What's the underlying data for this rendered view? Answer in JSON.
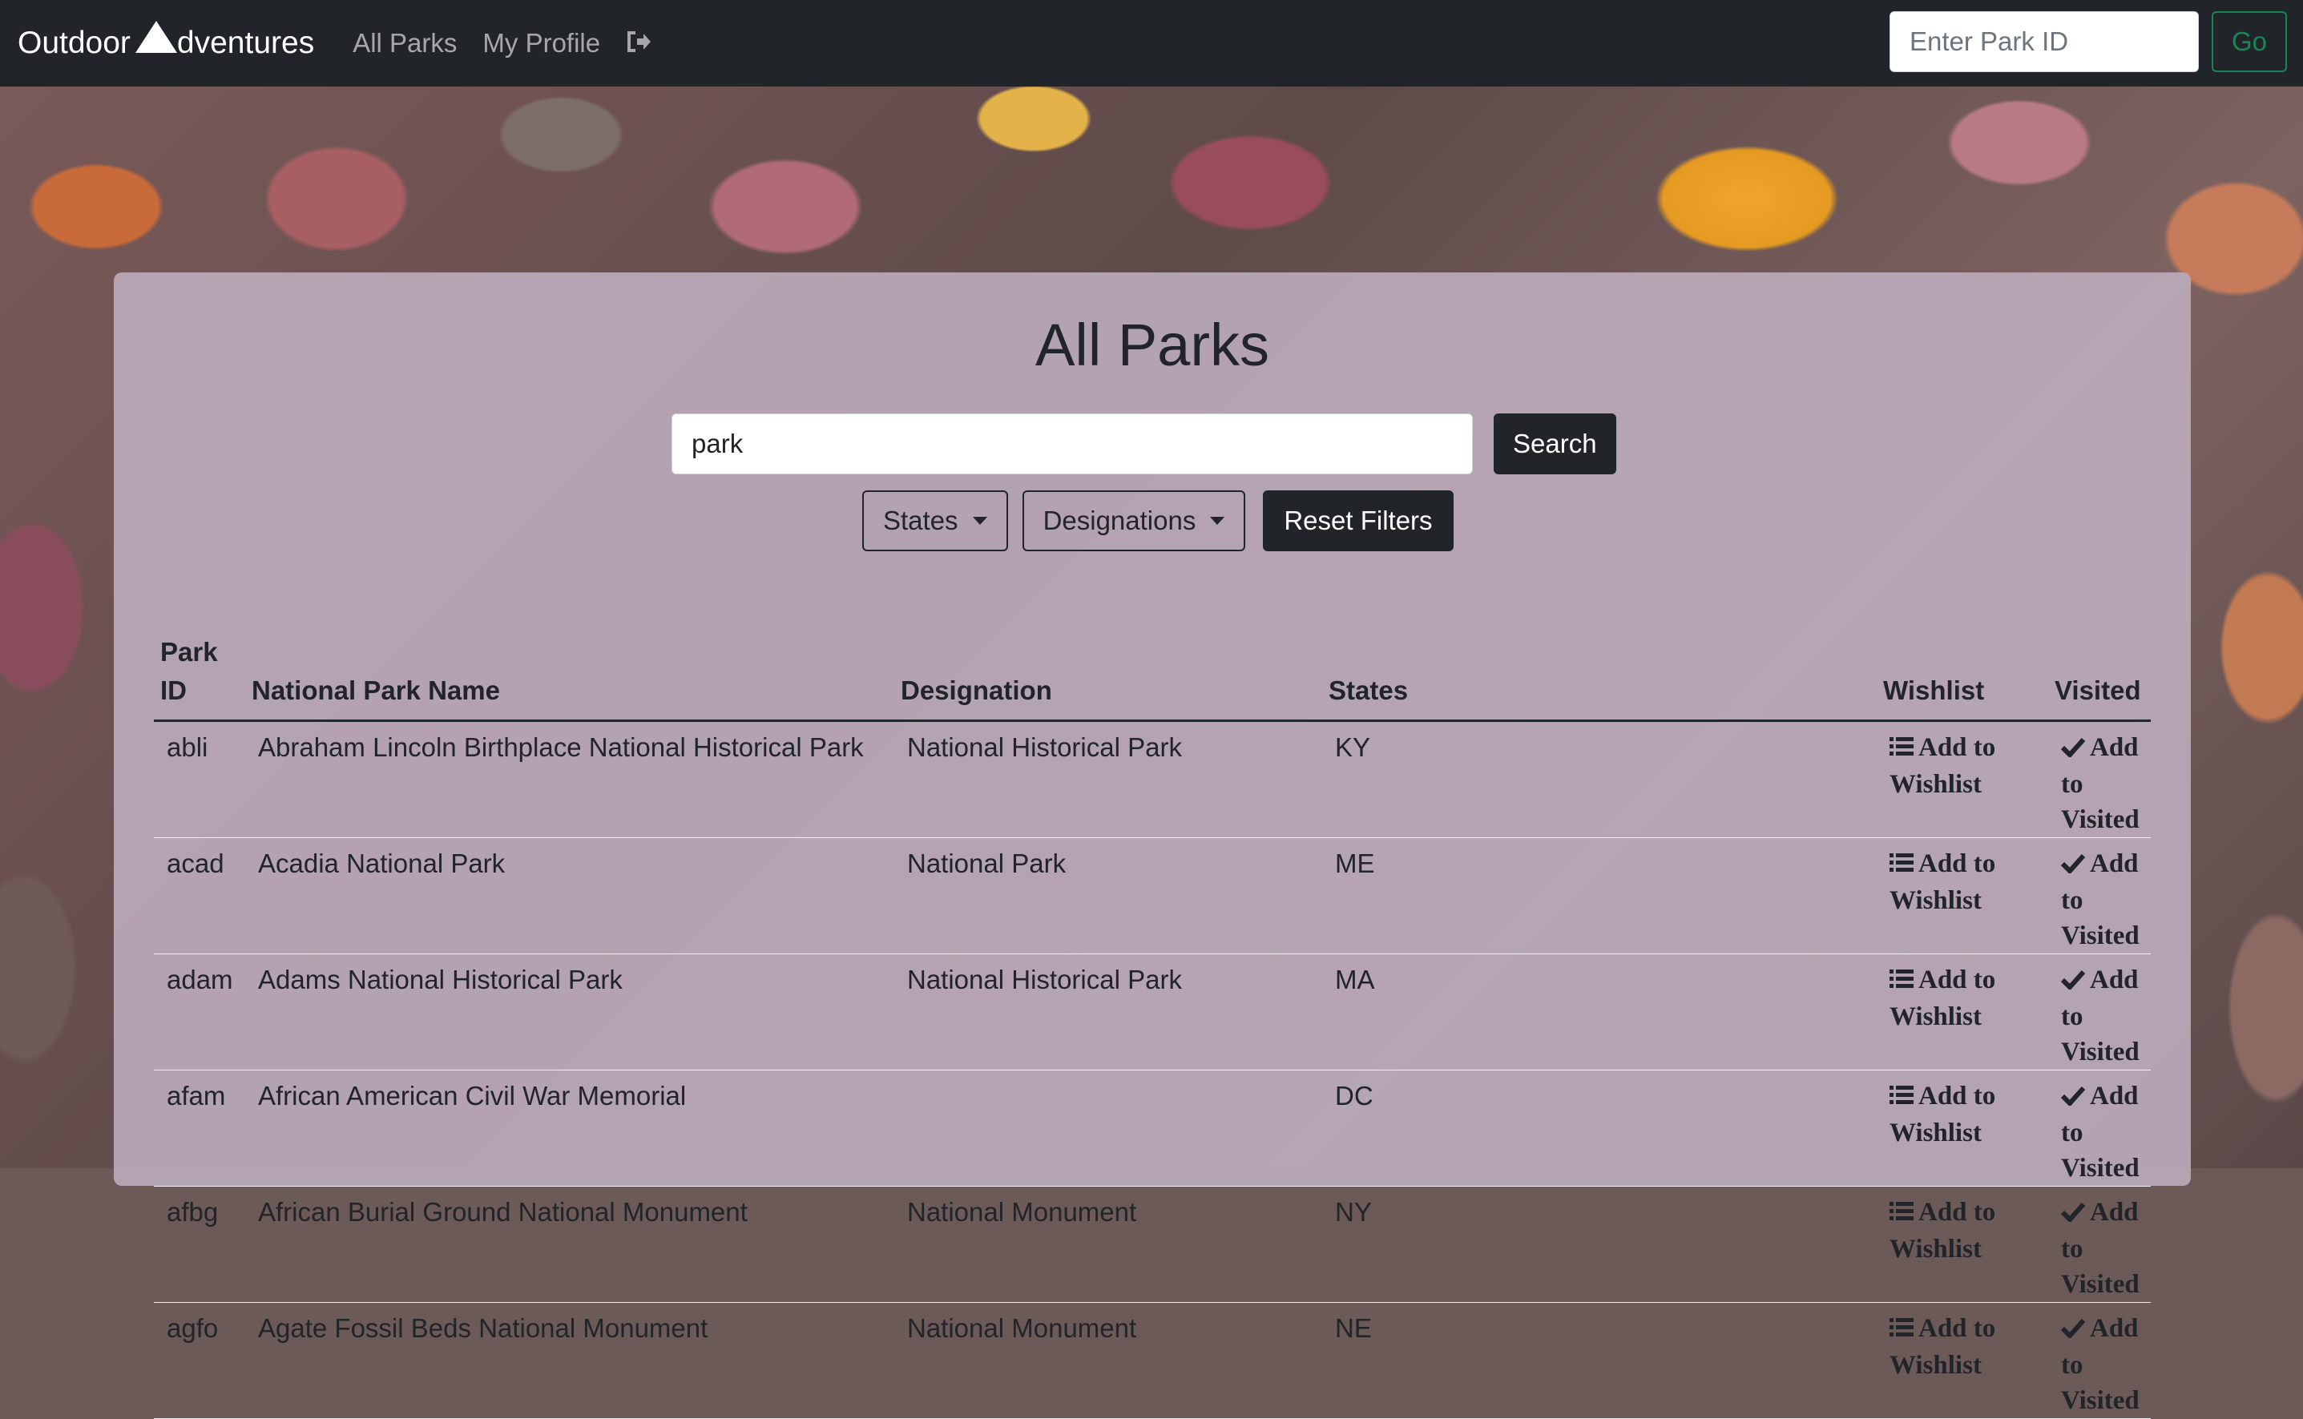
{
  "navbar": {
    "brand_before": "Outdoor ",
    "brand_after": "dventures",
    "links": [
      "All Parks",
      "My Profile"
    ],
    "park_id_placeholder": "Enter Park ID",
    "go_label": "Go"
  },
  "main": {
    "title": "All Parks",
    "search_value": "park",
    "search_label": "Search",
    "states_label": "States",
    "designations_label": "Designations",
    "reset_label": "Reset Filters"
  },
  "table": {
    "headers": {
      "id_line1": "Park",
      "id_line2": "ID",
      "name": "National Park Name",
      "designation": "Designation",
      "states": "States",
      "wishlist": "Wishlist",
      "visited": "Visited"
    },
    "wishlist_action": [
      "Add to",
      "Wishlist"
    ],
    "visited_action": [
      "Add to",
      "Visited"
    ],
    "rows": [
      {
        "id": "abli",
        "name": "Abraham Lincoln Birthplace National Historical Park",
        "designation": "National Historical Park",
        "states": "KY"
      },
      {
        "id": "acad",
        "name": "Acadia National Park",
        "designation": "National Park",
        "states": "ME"
      },
      {
        "id": "adam",
        "name": "Adams National Historical Park",
        "designation": "National Historical Park",
        "states": "MA"
      },
      {
        "id": "afam",
        "name": "African American Civil War Memorial",
        "designation": "",
        "states": "DC"
      },
      {
        "id": "afbg",
        "name": "African Burial Ground National Monument",
        "designation": "National Monument",
        "states": "NY"
      },
      {
        "id": "agfo",
        "name": "Agate Fossil Beds National Monument",
        "designation": "National Monument",
        "states": "NE"
      }
    ]
  },
  "icons": {
    "logo": "mountain-icon",
    "logout": "sign-out-icon",
    "wishlist": "list-icon",
    "visited": "check-icon"
  },
  "colors": {
    "navbar": "#212529",
    "go_button": "#198754",
    "card": "#bcacbc"
  }
}
